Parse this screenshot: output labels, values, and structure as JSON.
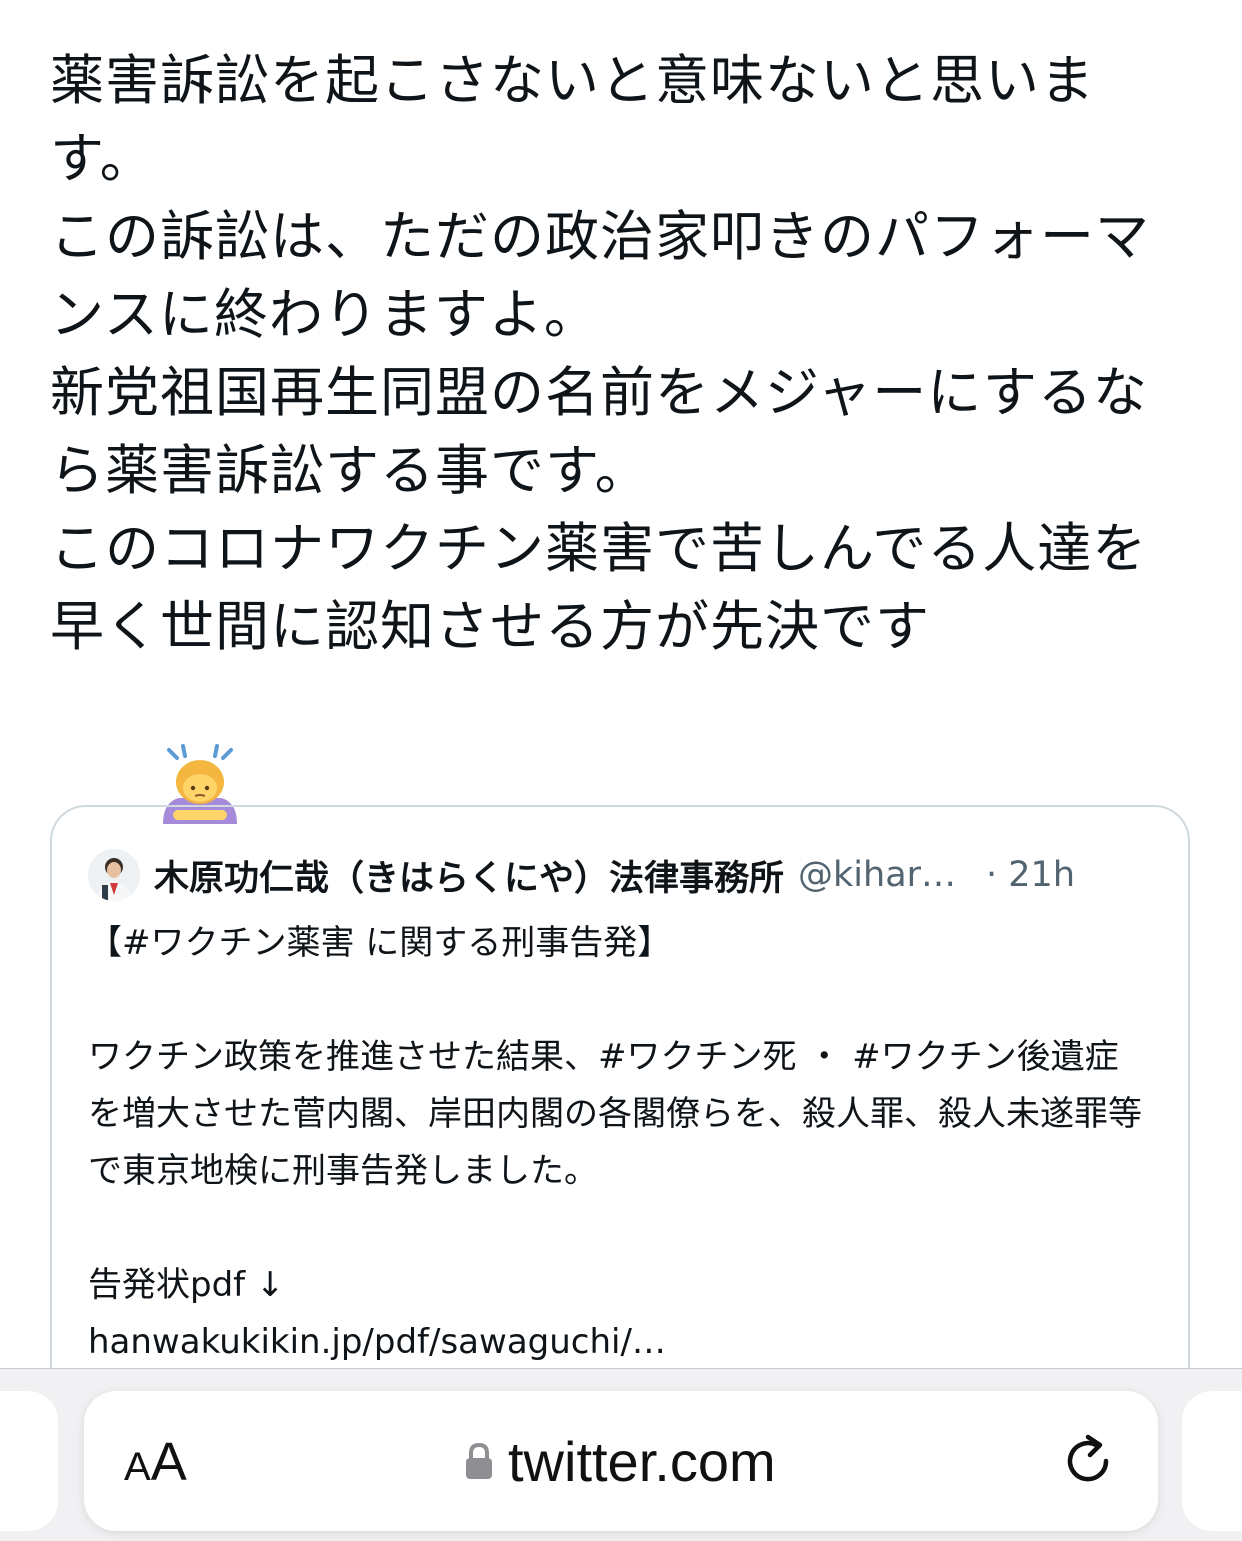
{
  "tweet": {
    "text": "薬害訴訟を起こさないと意味ないと思います。\nこの訴訟は、ただの政治家叩きのパフォーマンスに終わりますよ。\n新党祖国再生同盟の名前をメジャーにするなら薬害訴訟する事です。\nこのコロナワクチン薬害で苦しんでる人達を早く世間に認知させる方が先決です",
    "emoji": "woman-bowing-emoji"
  },
  "quote": {
    "author_name": "木原功仁哉（きはらくにや）法律事務所",
    "author_handle": "@kihar…",
    "time": "· 21h",
    "avatar": "profile-photo",
    "text": "【#ワクチン薬害 に関する刑事告発】\n\nワクチン政策を推進させた結果、#ワクチン死 ・ #ワクチン後遺症 を増大させた菅内閣、岸田内閣の各閣僚らを、殺人罪、殺人未遂罪等で東京地検に刑事告発しました。\n\n告発状pdf ↓\nhanwakukikin.jp/pdf/sawaguchi/…"
  },
  "browser": {
    "aa_small": "A",
    "aa_big": "A",
    "url": "twitter.com",
    "lock_icon": "lock-icon",
    "reload_icon": "reload-icon"
  }
}
